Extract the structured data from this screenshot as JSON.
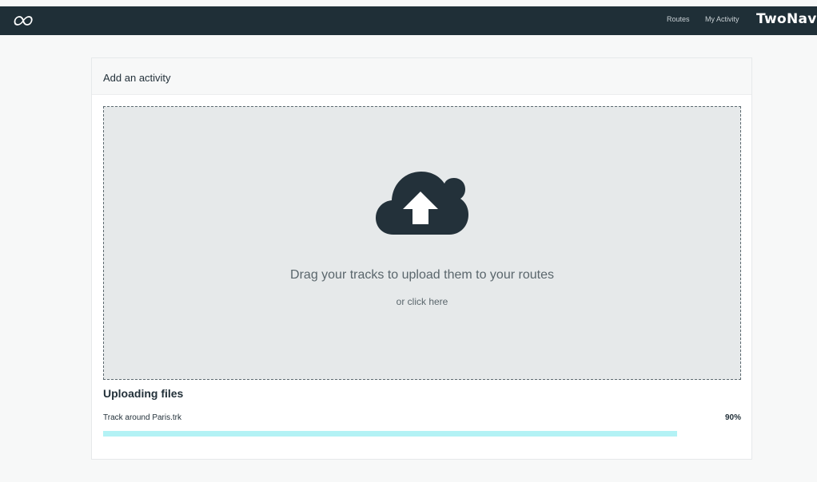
{
  "nav": {
    "logo_icon": "infinity-logo-icon",
    "routes_label": "Routes",
    "activity_label": "My Activity",
    "brand": "TwoNav"
  },
  "card": {
    "title": "Add an activity"
  },
  "dropzone": {
    "icon": "cloud-upload-icon",
    "text": "Drag your tracks to upload them to your routes",
    "sub_text": "or click here"
  },
  "uploads": {
    "title": "Uploading files",
    "files": [
      {
        "name": "Track around Paris.trk",
        "percent_label": "90%",
        "progress": 0.9
      }
    ]
  },
  "colors": {
    "topbar": "#1f2f37",
    "progress_fill": "#b3f2f5",
    "dropzone_bg": "#e6e9ea",
    "icon": "#23313a"
  }
}
